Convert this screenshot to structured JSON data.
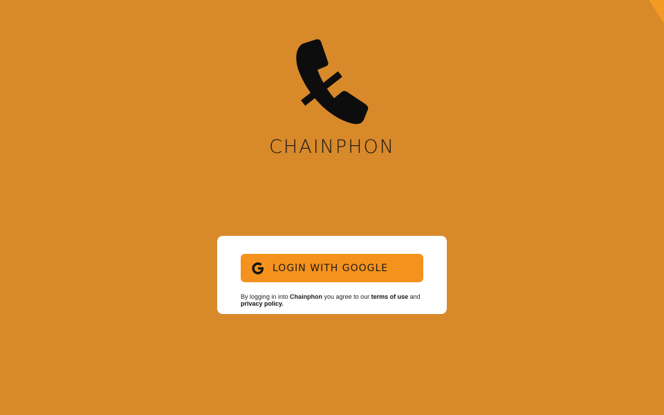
{
  "app": {
    "name": "Chainphon",
    "display_name": "CHAINPHON",
    "logo_icon": "phone-chain-icon"
  },
  "login": {
    "button_label": "LOGIN WITH GOOGLE",
    "button_icon": "google-g-icon",
    "legal": {
      "prefix": "By logging in into ",
      "brand": "Chainphon",
      "middle": " you agree to our ",
      "terms_label": "terms of use",
      "and": " and",
      "privacy_label": "privacy policy",
      "suffix": "."
    }
  },
  "colors": {
    "background": "#d8892a",
    "button": "#f5921d",
    "card": "#ffffff",
    "text": "#151515",
    "corner_accent": "#f29a23"
  }
}
